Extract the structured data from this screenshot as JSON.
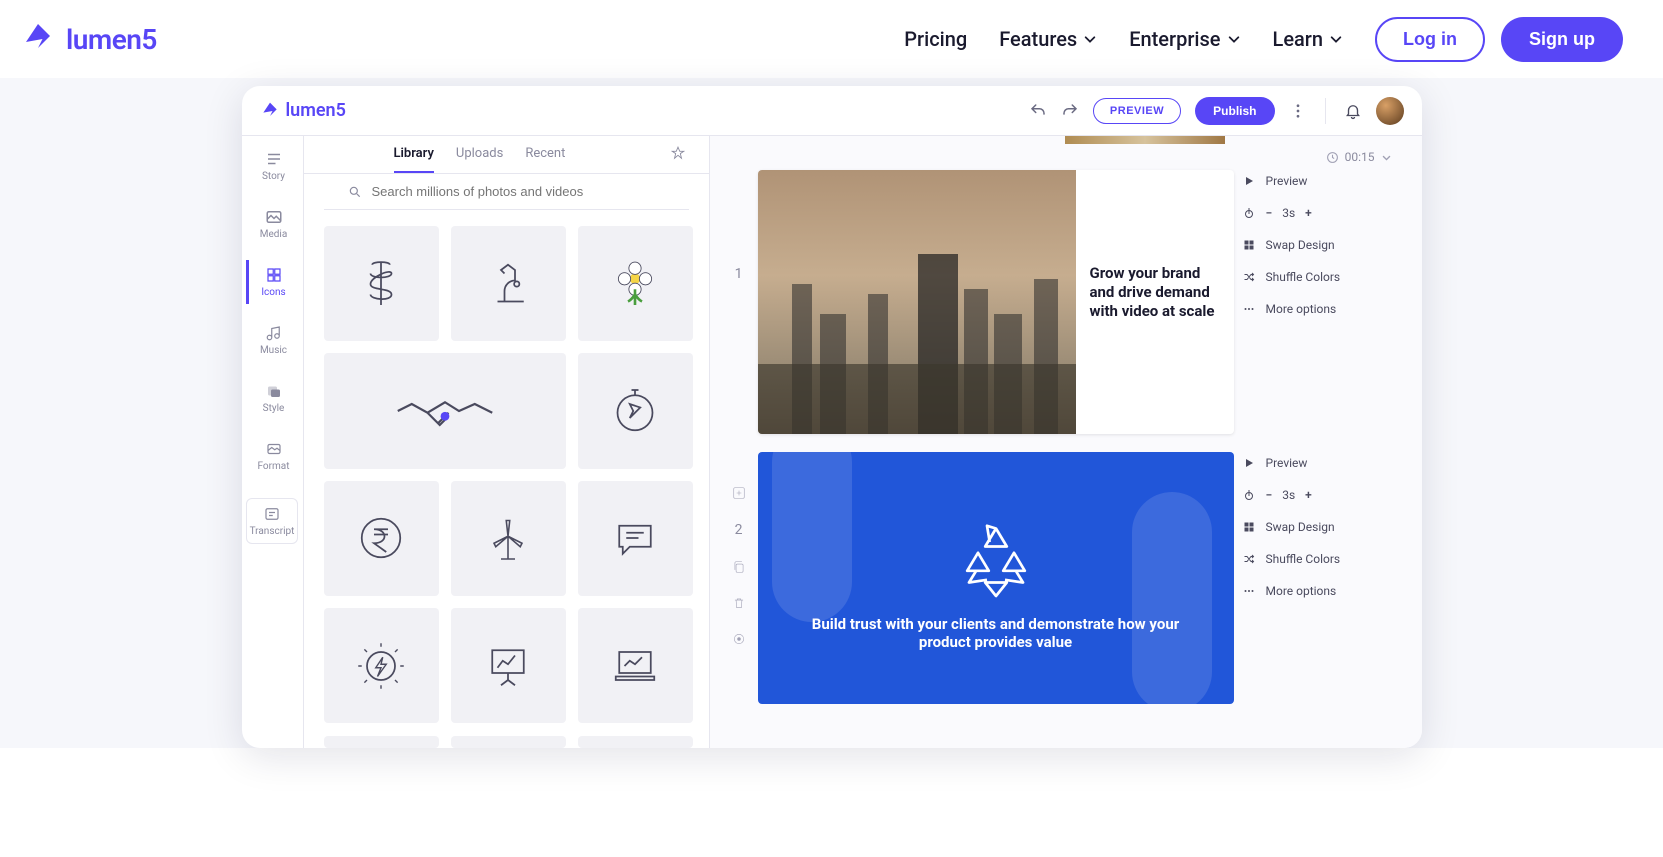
{
  "brand": {
    "name": "lumen5"
  },
  "nav": {
    "pricing": "Pricing",
    "features": "Features",
    "enterprise": "Enterprise",
    "learn": "Learn",
    "login": "Log in",
    "signup": "Sign up"
  },
  "app": {
    "brand": "lumen5",
    "preview_btn": "PREVIEW",
    "publish_btn": "Publish",
    "time_display": "00:15"
  },
  "sidebar": {
    "items": [
      {
        "label": "Story"
      },
      {
        "label": "Media"
      },
      {
        "label": "Icons"
      },
      {
        "label": "Music"
      },
      {
        "label": "Style"
      },
      {
        "label": "Format"
      },
      {
        "label": "Transcript"
      }
    ],
    "active_index": 2
  },
  "library": {
    "tabs": [
      {
        "label": "Library"
      },
      {
        "label": "Uploads"
      },
      {
        "label": "Recent"
      }
    ],
    "active_tab_index": 0,
    "search_placeholder": "Search millions of photos and videos",
    "icons": [
      "caduceus-icon",
      "microscope-icon",
      "flower-icon",
      "handshake-icon",
      "phone-chart-icon",
      "compass-icon",
      "rupee-icon",
      "wind-turbine-icon",
      "chat-icon",
      "lightbulb-bolt-icon",
      "presentation-icon",
      "laptop-chart-icon"
    ]
  },
  "slides": [
    {
      "index": "1",
      "text": "Grow your brand and drive demand with video at scale",
      "actions": {
        "preview": "Preview",
        "duration": "3s",
        "swap_design": "Swap Design",
        "shuffle_colors": "Shuffle Colors",
        "more_options": "More options"
      }
    },
    {
      "index": "2",
      "text": "Build trust with your clients and demonstrate how your product provides value",
      "actions": {
        "preview": "Preview",
        "duration": "3s",
        "swap_design": "Swap Design",
        "shuffle_colors": "Shuffle Colors",
        "more_options": "More options"
      }
    }
  ],
  "colors": {
    "brand": "#5846f6",
    "slide_blue": "#2156d9"
  }
}
